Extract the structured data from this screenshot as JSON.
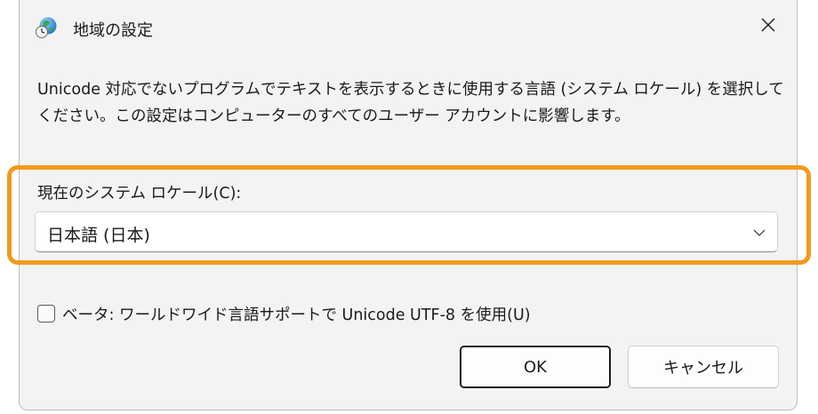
{
  "dialog": {
    "title": "地域の設定",
    "icon": "globe-clock-icon",
    "close_icon": "close-icon"
  },
  "description": "Unicode 対応でないプログラムでテキストを表示するときに使用する言語 (システム ロケール) を選択してください。この設定はコンピューターのすべてのユーザー アカウントに影響します。",
  "locale": {
    "label": "現在のシステム ロケール(C):",
    "selected": "日本語 (日本)",
    "highlight_color": "#f39a1e"
  },
  "beta": {
    "checked": false,
    "label": "ベータ: ワールドワイド言語サポートで Unicode UTF-8 を使用(U)"
  },
  "buttons": {
    "ok": "OK",
    "cancel": "キャンセル"
  }
}
